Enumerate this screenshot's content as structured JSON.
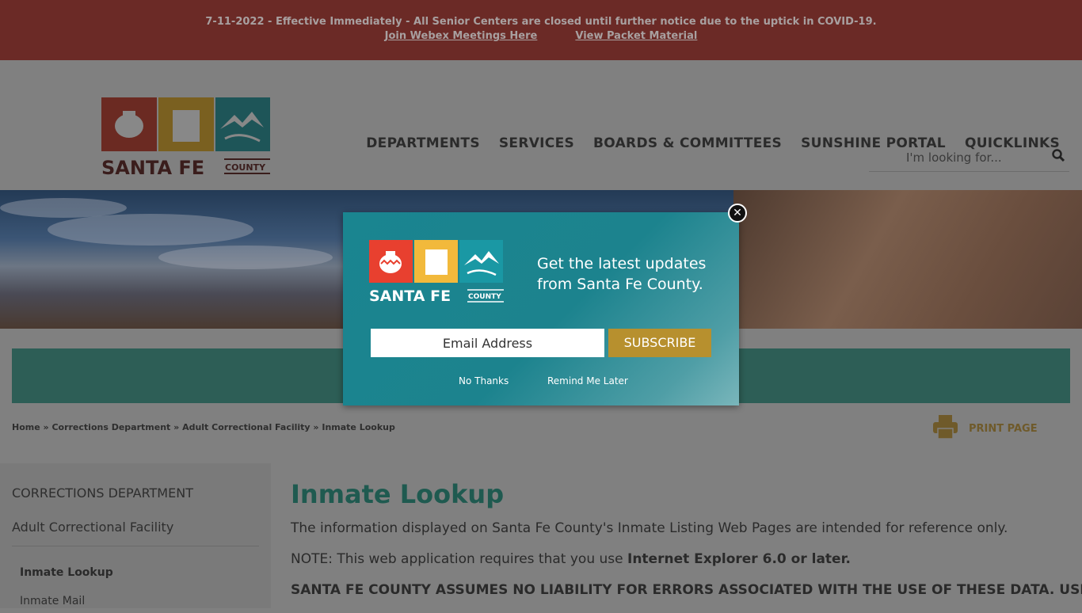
{
  "alert": {
    "message": "7-11-2022 - Effective Immediately - All Senior Centers are closed until further notice due to the uptick in COVID-19.",
    "links": [
      "Join Webex Meetings Here",
      "View Packet Material"
    ]
  },
  "logo": {
    "name": "SANTA FE",
    "sub": "COUNTY",
    "colors": [
      "#d9453a",
      "#f0b93a",
      "#1a96a0"
    ]
  },
  "search": {
    "placeholder": "I'm looking for...",
    "icon": "search-icon"
  },
  "nav": [
    "DEPARTMENTS",
    "SERVICES",
    "BOARDS & COMMITTEES",
    "SUNSHINE PORTAL",
    "QUICKLINKS"
  ],
  "breadcrumb": {
    "items": [
      "Home",
      "Corrections Department",
      "Adult Correctional Facility",
      "Inmate Lookup"
    ],
    "sep": " » "
  },
  "print": {
    "label": "PRINT PAGE",
    "icon": "printer-icon"
  },
  "sidebar": {
    "section": "CORRECTIONS DEPARTMENT",
    "parent": "Adult Correctional Facility",
    "items": [
      "Inmate Lookup",
      "Inmate Mail"
    ]
  },
  "main": {
    "title": "Inmate Lookup",
    "p1": "The information displayed on Santa Fe County's Inmate Listing Web Pages are intended for reference only.",
    "p2_prefix": "NOTE: This web application requires that you use ",
    "p2_bold": "Internet Explorer 6.0 or later.",
    "p3": "SANTA FE COUNTY ASSUMES NO LIABILITY FOR ERRORS ASSOCIATED WITH THE USE OF THESE DATA. USERS"
  },
  "popup": {
    "message": "Get the latest updates from Santa Fe County.",
    "email_placeholder": "Email Address",
    "subscribe": "SUBSCRIBE",
    "no_thanks": "No Thanks",
    "remind": "Remind Me Later",
    "close_icon": "close-icon"
  }
}
